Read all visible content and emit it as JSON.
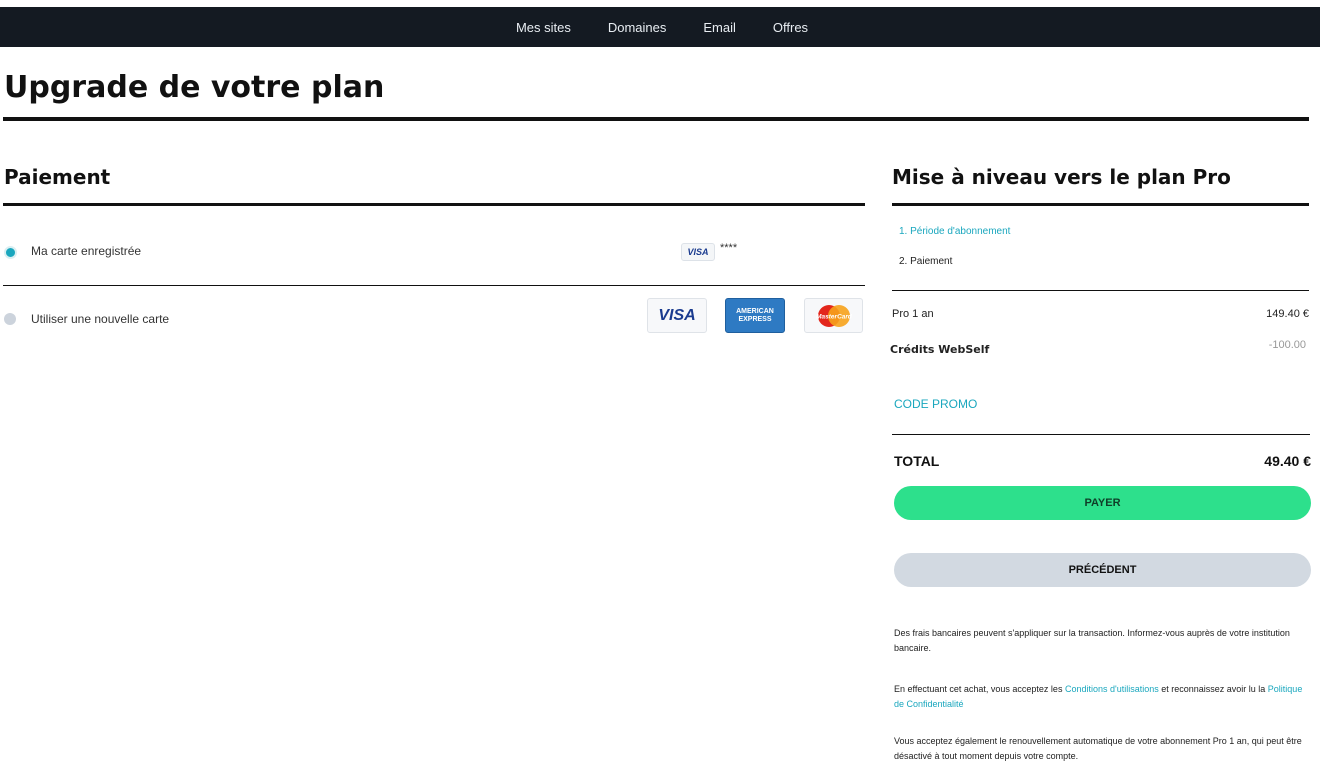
{
  "nav": {
    "items": [
      {
        "label": "Mes sites"
      },
      {
        "label": "Domaines"
      },
      {
        "label": "Email"
      },
      {
        "label": "Offres"
      }
    ]
  },
  "page": {
    "title": "Upgrade de votre plan"
  },
  "payment": {
    "title": "Paiement",
    "saved_card": {
      "label": "Ma carte enregistrée",
      "brand": "VISA",
      "masked_number": "****",
      "selected": true
    },
    "new_card": {
      "label": "Utiliser une nouvelle carte",
      "selected": false
    },
    "accepted_cards": {
      "visa": "VISA",
      "amex_line1": "AMERICAN",
      "amex_line2": "EXPRESS",
      "mastercard": "MasterCard"
    }
  },
  "summary": {
    "title": "Mise à niveau vers le plan Pro",
    "steps": [
      {
        "label": "1. Période d'abonnement",
        "active": true
      },
      {
        "label": "2. Paiement",
        "active": false
      }
    ],
    "lines": [
      {
        "label": "Pro 1 an",
        "value": "149.40 €"
      },
      {
        "label": "Crédits WebSelf",
        "value": "-100.00"
      }
    ],
    "promo_label": "CODE PROMO",
    "total_label": "TOTAL",
    "total_value": "49.40 €",
    "pay_button": "PAYER",
    "back_button": "PRÉCÉDENT"
  },
  "legal": {
    "fees_note": "Des frais bancaires peuvent s'appliquer sur la transaction. Informez-vous auprès de votre institution bancaire.",
    "terms_prefix": "En effectuant cet achat, vous acceptez les ",
    "terms_link": "Conditions d'utilisations",
    "terms_middle": " et reconnaissez avoir lu la ",
    "privacy_link": "Politique de Confidentialité",
    "renewal_note": "Vous acceptez également le renouvellement automatique de votre abonnement Pro 1 an, qui peut être désactivé à tout moment depuis votre compte."
  },
  "colors": {
    "accent": "#1aa7be",
    "pay_button": "#2de08c",
    "back_button": "#d2d9e1",
    "nav_bg": "#141a22"
  }
}
